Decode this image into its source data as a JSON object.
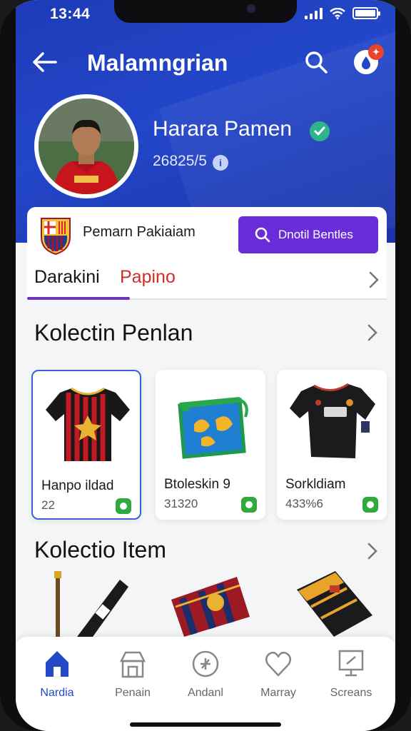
{
  "status_bar": {
    "time": "13:44"
  },
  "header": {
    "title": "Malamngrian"
  },
  "profile": {
    "name": "Harara Pamen",
    "id": "26825/5",
    "info_glyph": "i"
  },
  "notification": {
    "badge_glyph": "✦"
  },
  "club": {
    "name": "Pemarn Pakiaiam",
    "cta_label": "Dnotil Bentles"
  },
  "tabs": [
    {
      "label": "Darakini"
    },
    {
      "label": "Papino"
    }
  ],
  "sections": {
    "collection_title": "Kolectin Penlan",
    "items_title": "Kolectio Item"
  },
  "collection_cards": [
    {
      "title": "Hanpo ildad",
      "sub": "22"
    },
    {
      "title": "Btoleskin 9",
      "sub": "31320"
    },
    {
      "title": "Sorkldiam",
      "sub": "433%6"
    }
  ],
  "bottom_nav": [
    {
      "label": "Nardia",
      "icon": "home-icon"
    },
    {
      "label": "Penain",
      "icon": "store-icon"
    },
    {
      "label": "Andanl",
      "icon": "compass-icon"
    },
    {
      "label": "Marray",
      "icon": "heart-icon"
    },
    {
      "label": "Screans",
      "icon": "monitor-icon"
    }
  ],
  "colors": {
    "brand_blue": "#2347c9",
    "cta_purple": "#6a2bd9",
    "tab_red": "#d42a2a",
    "active_nav": "#2349c7"
  }
}
